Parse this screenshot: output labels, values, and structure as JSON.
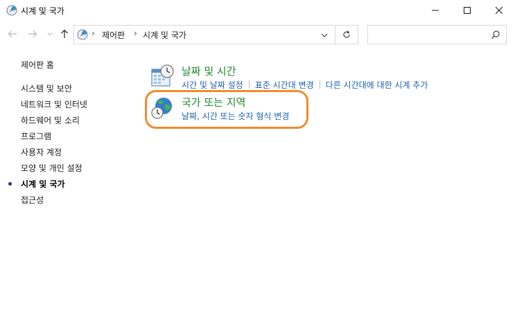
{
  "window": {
    "title": "시계 및 국가",
    "title_icon": "clock-globe-icon",
    "buttons": [
      "minimize-icon",
      "maximize-icon",
      "close-icon"
    ]
  },
  "address": {
    "crumbs": [
      "제어판",
      "시계 및 국가"
    ],
    "separator": "›",
    "search_placeholder": ""
  },
  "left_nav": {
    "home": "제어판 홈",
    "items": [
      {
        "label": "시스템 및 보안",
        "active": false
      },
      {
        "label": "네트워크 및 인터넷",
        "active": false
      },
      {
        "label": "하드웨어 및 소리",
        "active": false
      },
      {
        "label": "프로그램",
        "active": false
      },
      {
        "label": "사용자 계정",
        "active": false
      },
      {
        "label": "모양 및 개인 설정",
        "active": false
      },
      {
        "label": "시계 및 국가",
        "active": true
      },
      {
        "label": "접근성",
        "active": false
      }
    ]
  },
  "categories": [
    {
      "title": "날짜 및 시간",
      "icon": "calendar-clock-icon",
      "links": [
        "시간 및 날짜 설정",
        "표준 시간대 변경",
        "다른 시간대에 대한 시계 추가"
      ]
    },
    {
      "title": "국가 또는 지역",
      "icon": "globe-clock-icon",
      "links": [
        "날짜, 시간 또는 숫자 형식 변경"
      ]
    }
  ],
  "colors": {
    "category_title": "#1e8a2a",
    "link": "#1a5fb4",
    "highlight": "#f28b2b",
    "bullet": "#1f3a6e"
  }
}
